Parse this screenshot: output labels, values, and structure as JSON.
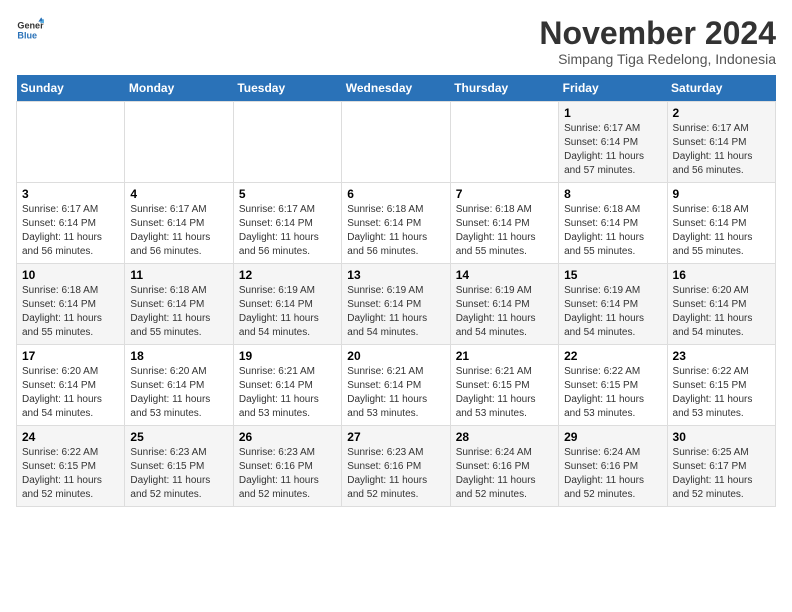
{
  "logo": {
    "line1": "General",
    "line2": "Blue"
  },
  "title": "November 2024",
  "subtitle": "Simpang Tiga Redelong, Indonesia",
  "days_header": [
    "Sunday",
    "Monday",
    "Tuesday",
    "Wednesday",
    "Thursday",
    "Friday",
    "Saturday"
  ],
  "weeks": [
    [
      {
        "day": "",
        "info": ""
      },
      {
        "day": "",
        "info": ""
      },
      {
        "day": "",
        "info": ""
      },
      {
        "day": "",
        "info": ""
      },
      {
        "day": "",
        "info": ""
      },
      {
        "day": "1",
        "info": "Sunrise: 6:17 AM\nSunset: 6:14 PM\nDaylight: 11 hours\nand 57 minutes."
      },
      {
        "day": "2",
        "info": "Sunrise: 6:17 AM\nSunset: 6:14 PM\nDaylight: 11 hours\nand 56 minutes."
      }
    ],
    [
      {
        "day": "3",
        "info": "Sunrise: 6:17 AM\nSunset: 6:14 PM\nDaylight: 11 hours\nand 56 minutes."
      },
      {
        "day": "4",
        "info": "Sunrise: 6:17 AM\nSunset: 6:14 PM\nDaylight: 11 hours\nand 56 minutes."
      },
      {
        "day": "5",
        "info": "Sunrise: 6:17 AM\nSunset: 6:14 PM\nDaylight: 11 hours\nand 56 minutes."
      },
      {
        "day": "6",
        "info": "Sunrise: 6:18 AM\nSunset: 6:14 PM\nDaylight: 11 hours\nand 56 minutes."
      },
      {
        "day": "7",
        "info": "Sunrise: 6:18 AM\nSunset: 6:14 PM\nDaylight: 11 hours\nand 55 minutes."
      },
      {
        "day": "8",
        "info": "Sunrise: 6:18 AM\nSunset: 6:14 PM\nDaylight: 11 hours\nand 55 minutes."
      },
      {
        "day": "9",
        "info": "Sunrise: 6:18 AM\nSunset: 6:14 PM\nDaylight: 11 hours\nand 55 minutes."
      }
    ],
    [
      {
        "day": "10",
        "info": "Sunrise: 6:18 AM\nSunset: 6:14 PM\nDaylight: 11 hours\nand 55 minutes."
      },
      {
        "day": "11",
        "info": "Sunrise: 6:18 AM\nSunset: 6:14 PM\nDaylight: 11 hours\nand 55 minutes."
      },
      {
        "day": "12",
        "info": "Sunrise: 6:19 AM\nSunset: 6:14 PM\nDaylight: 11 hours\nand 54 minutes."
      },
      {
        "day": "13",
        "info": "Sunrise: 6:19 AM\nSunset: 6:14 PM\nDaylight: 11 hours\nand 54 minutes."
      },
      {
        "day": "14",
        "info": "Sunrise: 6:19 AM\nSunset: 6:14 PM\nDaylight: 11 hours\nand 54 minutes."
      },
      {
        "day": "15",
        "info": "Sunrise: 6:19 AM\nSunset: 6:14 PM\nDaylight: 11 hours\nand 54 minutes."
      },
      {
        "day": "16",
        "info": "Sunrise: 6:20 AM\nSunset: 6:14 PM\nDaylight: 11 hours\nand 54 minutes."
      }
    ],
    [
      {
        "day": "17",
        "info": "Sunrise: 6:20 AM\nSunset: 6:14 PM\nDaylight: 11 hours\nand 54 minutes."
      },
      {
        "day": "18",
        "info": "Sunrise: 6:20 AM\nSunset: 6:14 PM\nDaylight: 11 hours\nand 53 minutes."
      },
      {
        "day": "19",
        "info": "Sunrise: 6:21 AM\nSunset: 6:14 PM\nDaylight: 11 hours\nand 53 minutes."
      },
      {
        "day": "20",
        "info": "Sunrise: 6:21 AM\nSunset: 6:14 PM\nDaylight: 11 hours\nand 53 minutes."
      },
      {
        "day": "21",
        "info": "Sunrise: 6:21 AM\nSunset: 6:15 PM\nDaylight: 11 hours\nand 53 minutes."
      },
      {
        "day": "22",
        "info": "Sunrise: 6:22 AM\nSunset: 6:15 PM\nDaylight: 11 hours\nand 53 minutes."
      },
      {
        "day": "23",
        "info": "Sunrise: 6:22 AM\nSunset: 6:15 PM\nDaylight: 11 hours\nand 53 minutes."
      }
    ],
    [
      {
        "day": "24",
        "info": "Sunrise: 6:22 AM\nSunset: 6:15 PM\nDaylight: 11 hours\nand 52 minutes."
      },
      {
        "day": "25",
        "info": "Sunrise: 6:23 AM\nSunset: 6:15 PM\nDaylight: 11 hours\nand 52 minutes."
      },
      {
        "day": "26",
        "info": "Sunrise: 6:23 AM\nSunset: 6:16 PM\nDaylight: 11 hours\nand 52 minutes."
      },
      {
        "day": "27",
        "info": "Sunrise: 6:23 AM\nSunset: 6:16 PM\nDaylight: 11 hours\nand 52 minutes."
      },
      {
        "day": "28",
        "info": "Sunrise: 6:24 AM\nSunset: 6:16 PM\nDaylight: 11 hours\nand 52 minutes."
      },
      {
        "day": "29",
        "info": "Sunrise: 6:24 AM\nSunset: 6:16 PM\nDaylight: 11 hours\nand 52 minutes."
      },
      {
        "day": "30",
        "info": "Sunrise: 6:25 AM\nSunset: 6:17 PM\nDaylight: 11 hours\nand 52 minutes."
      }
    ]
  ]
}
